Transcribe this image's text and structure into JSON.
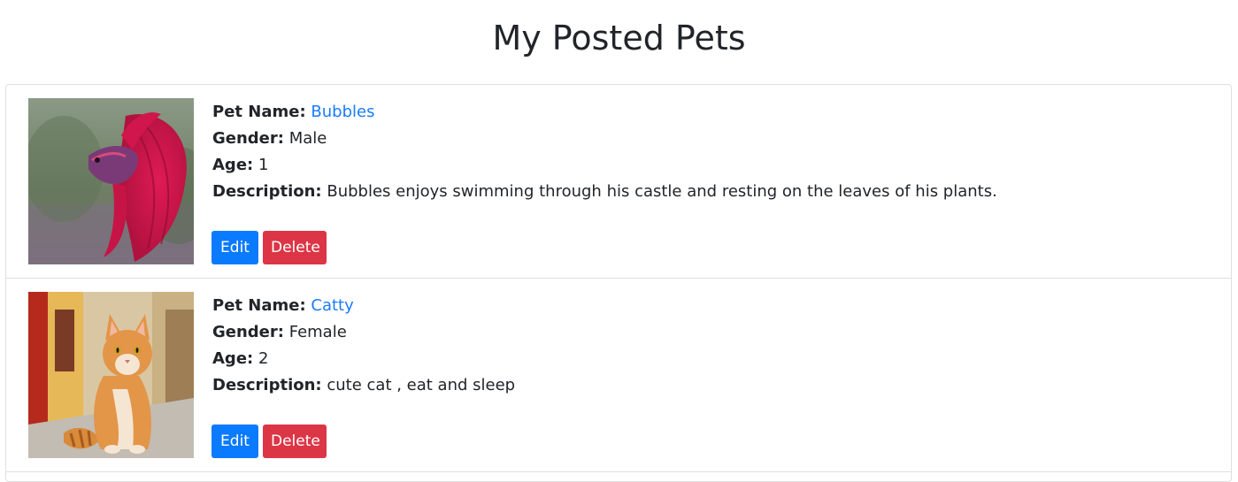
{
  "page": {
    "title": "My Posted Pets"
  },
  "labels": {
    "pet_name": "Pet Name:",
    "gender": "Gender:",
    "age": "Age:",
    "description": "Description:",
    "edit": "Edit",
    "delete": "Delete"
  },
  "pets": [
    {
      "name": "Bubbles",
      "gender": "Male",
      "age": "1",
      "description": "Bubbles enjoys swimming through his castle and resting on the leaves of his plants."
    },
    {
      "name": "Catty",
      "gender": "Female",
      "age": "2",
      "description": "cute cat , eat and sleep"
    }
  ],
  "colors": {
    "link": "#1a7bff",
    "edit_button": "#0a7aff",
    "delete_button": "#dc3545",
    "border": "#dfdfdf"
  }
}
